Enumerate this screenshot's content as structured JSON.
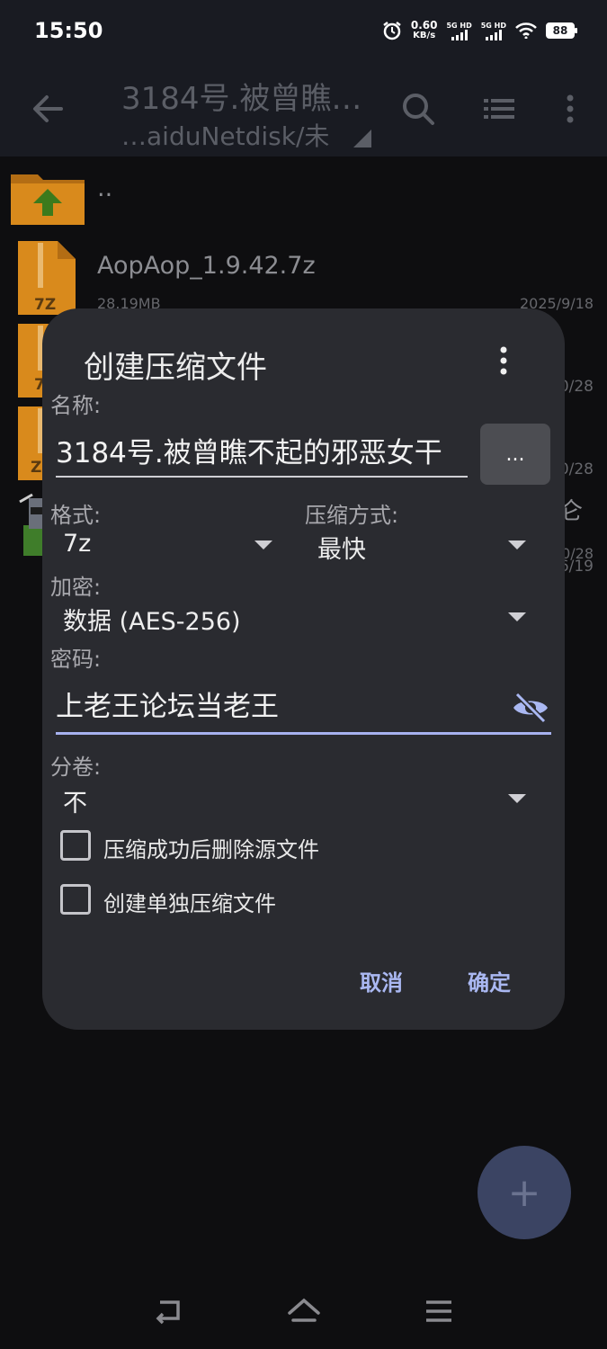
{
  "status": {
    "time": "15:50",
    "net_speed_value": "0.60",
    "net_speed_unit": "KB/s",
    "sim1": "5G HD",
    "sim2": "5G HD",
    "battery": "88"
  },
  "appbar": {
    "title": "3184号.被曾瞧…",
    "path": "…aiduNetdisk/未"
  },
  "files": [
    {
      "name": "..",
      "size": "",
      "date": "",
      "type": "parent"
    },
    {
      "name": "AopAop_1.9.42.7z",
      "size": "28.19MB",
      "date": "2025/9/18",
      "type": "7z"
    },
    {
      "name": "",
      "size": "",
      "date": "0/28",
      "type": "7z"
    },
    {
      "name": "",
      "size": "",
      "date": "0/28",
      "type": "zip"
    },
    {
      "name": "仑",
      "size": "",
      "date": "6/19",
      "type": "image"
    }
  ],
  "file_badges": {
    "f1": "7Z",
    "f2": "7",
    "f3": "Z"
  },
  "dialog": {
    "title": "创建压缩文件",
    "name_label": "名称:",
    "name_value": "3184号.被曾瞧不起的邪恶女干",
    "browse_label": "...",
    "format_label": "格式:",
    "format_value": "7z",
    "method_label": "压缩方式:",
    "method_value": "最快",
    "encryption_label": "加密:",
    "encryption_value": "数据 (AES-256)",
    "password_label": "密码:",
    "password_value": "上老王论坛当老王",
    "split_label": "分卷:",
    "split_value": "不",
    "delete_source_label": "压缩成功后删除源文件",
    "separate_archives_label": "创建单独压缩文件",
    "cancel_label": "取消",
    "ok_label": "确定"
  },
  "fab_label": "+",
  "colors": {
    "accent": "#aab8f2",
    "dialog_bg": "#2a2b30",
    "appbar_bg": "#191b22",
    "folder": "#d98a1c",
    "fab": "#3b4463"
  }
}
